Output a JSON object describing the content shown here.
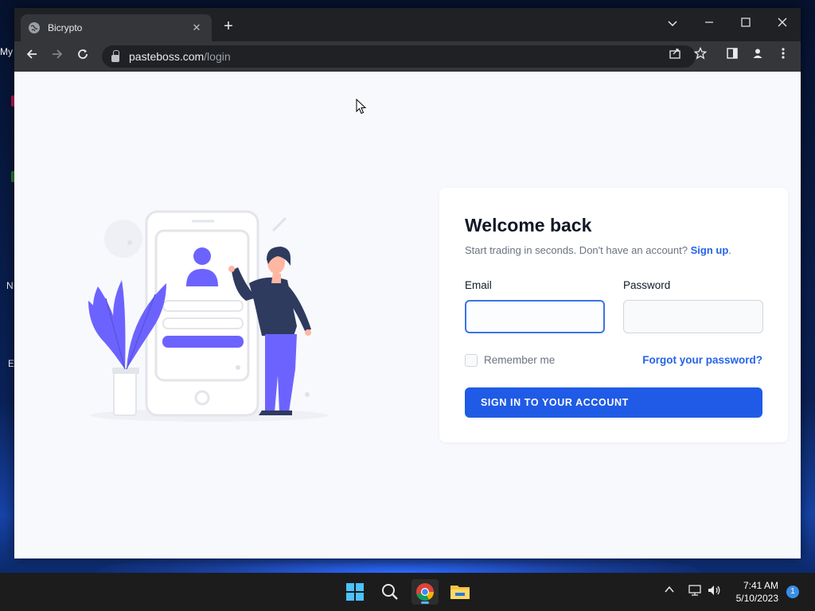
{
  "desktop": {
    "icons": [
      {
        "label": "My"
      },
      {
        "label": "N"
      },
      {
        "label": "E"
      }
    ]
  },
  "browser": {
    "tab_title": "Bicrypto",
    "new_tab": "+",
    "url_host": "pasteboss.com",
    "url_path": "/login"
  },
  "login": {
    "heading": "Welcome back",
    "subtitle": "Start trading in seconds. Don't have an account?",
    "signup_link": "Sign up",
    "signup_period": ".",
    "email_label": "Email",
    "email_value": "",
    "password_label": "Password",
    "password_value": "",
    "remember_label": "Remember me",
    "forgot_link": "Forgot your password?",
    "submit_label": "SIGN IN TO YOUR ACCOUNT"
  },
  "taskbar": {
    "time": "7:41 AM",
    "date": "5/10/2023",
    "notification_count": "1"
  },
  "colors": {
    "accent": "#1f5be6",
    "link": "#2563eb",
    "illustration": "#6c63ff",
    "navy": "#2f3a5f"
  }
}
